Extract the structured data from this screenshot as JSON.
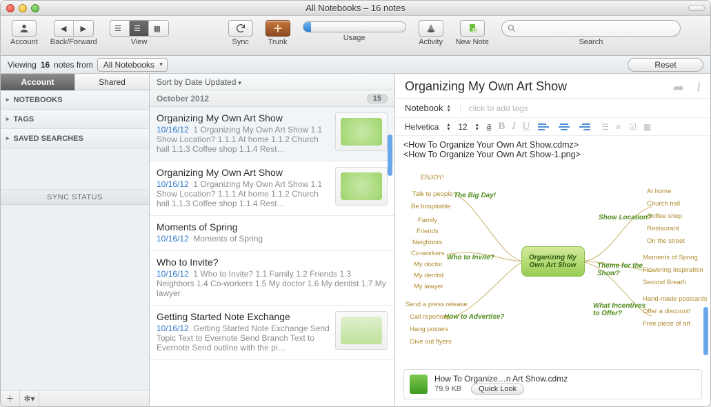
{
  "window": {
    "title": "All Notebooks – 16 notes"
  },
  "toolbar": {
    "account": "Account",
    "backforward": "Back/Forward",
    "view": "View",
    "sync": "Sync",
    "trunk": "Trunk",
    "usage": "Usage",
    "activity": "Activity",
    "newnote": "New Note",
    "search": "Search",
    "search_placeholder": ""
  },
  "subbar": {
    "viewing_pre": "Viewing ",
    "count": "16",
    "viewing_post": " notes from ",
    "scope": "All Notebooks",
    "reset": "Reset"
  },
  "sidebar": {
    "tabs": {
      "account": "Account",
      "shared": "Shared"
    },
    "sections": {
      "notebooks": "NOTEBOOKS",
      "tags": "TAGS",
      "saved": "SAVED SEARCHES"
    },
    "sync_status": "SYNC STATUS"
  },
  "list": {
    "sort_label": "Sort by Date Updated",
    "group": {
      "label": "October 2012",
      "count": "15"
    },
    "notes": [
      {
        "title": "Organizing My Own Art Show",
        "date": "10/16/12",
        "snip": "1 Organizing My Own Art Show 1.1 Show Location? 1.1.1 At home 1.1.2 Church hall 1.1.3 Coffee shop 1.1.4 Rest…",
        "thumb": true,
        "selected": true
      },
      {
        "title": "Organizing My Own Art Show",
        "date": "10/16/12",
        "snip": "1 Organizing My Own Art Show 1.1 Show Location? 1.1.1 At home 1.1.2 Church hall 1.1.3 Coffee shop 1.1.4 Rest…",
        "thumb": true
      },
      {
        "title": "Moments of Spring",
        "date": "10/16/12",
        "snip": "Moments of Spring",
        "thumb": false
      },
      {
        "title": "Who to Invite?",
        "date": "10/16/12",
        "snip": "1 Who to Invite? 1.1 Family 1.2 Friends 1.3 Neighbors 1.4 Co-workers 1.5 My doctor 1.6 My dentist 1.7 My lawyer",
        "thumb": false
      },
      {
        "title": "Getting Started Note Exchange",
        "date": "10/16/12",
        "snip": "Getting Started Note Exchange Send Topic Text to Evernote Send Branch Text to Evernote Send outline with the pi…",
        "thumb": true
      }
    ]
  },
  "detail": {
    "title": "Organizing My Own Art Show",
    "notebook_label": "Notebook",
    "tags_placeholder": "click to add tags",
    "font": "Helvetica",
    "size": "12",
    "body_line1": "<How To Organize Your Own Art Show.cdmz>",
    "body_line2": "<How To Organize Your Own Art Show-1.png>",
    "mindmap": {
      "center": "Organizing My Own Art Show",
      "branches": {
        "big_day": {
          "label": "The Big Day!",
          "leaves": [
            "ENJOY!",
            "Talk to people",
            "Be hospitable"
          ]
        },
        "invite": {
          "label": "Who to Invite?",
          "leaves": [
            "Family",
            "Friends",
            "Neighbors",
            "Co-workers",
            "My doctor",
            "My dentist",
            "My lawyer"
          ]
        },
        "advert": {
          "label": "How to Advertise?",
          "leaves": [
            "Send a press release",
            "Call reporters",
            "Hang posters",
            "Give out flyers"
          ]
        },
        "location": {
          "label": "Show Location?",
          "leaves": [
            "At home",
            "Church hall",
            "Coffee shop",
            "Restaurant",
            "On the street"
          ]
        },
        "theme": {
          "label": "Theme for the Show?",
          "leaves": [
            "Moments of Spring",
            "Flowering Inspiration",
            "Second Breath"
          ]
        },
        "incent": {
          "label": "What Incentives to Offer?",
          "leaves": [
            "Hand-made postcards",
            "Offer a discount!",
            "Free piece of art"
          ]
        }
      }
    },
    "attachment": {
      "name": "How To Organize…n Art Show.cdmz",
      "size": "79.9 KB",
      "quicklook": "Quick Look"
    }
  }
}
